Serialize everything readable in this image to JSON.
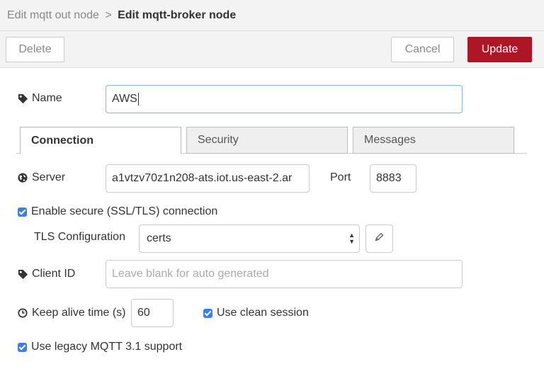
{
  "header": {
    "breadcrumb_prev": "Edit mqtt out node",
    "breadcrumb_sep": ">",
    "title": "Edit mqtt-broker node"
  },
  "toolbar": {
    "delete_label": "Delete",
    "cancel_label": "Cancel",
    "update_label": "Update",
    "update_color": "#ad1625"
  },
  "form": {
    "name_label": "Name",
    "name_value": "AWS",
    "tabs": [
      "Connection",
      "Security",
      "Messages"
    ],
    "active_tab": "Connection",
    "server_label": "Server",
    "server_value": "a1vtzv70z1n208-ats.iot.us-east-2.ar",
    "port_label": "Port",
    "port_value": "8883",
    "tls_checkbox_label": "Enable secure (SSL/TLS) connection",
    "tls_checked": true,
    "tls_config_label": "TLS Configuration",
    "tls_config_value": "certs",
    "client_id_label": "Client ID",
    "client_id_placeholder": "Leave blank for auto generated",
    "keepalive_label": "Keep alive time (s)",
    "keepalive_value": "60",
    "clean_session_label": "Use clean session",
    "clean_session_checked": true,
    "legacy_label": "Use legacy MQTT 3.1 support",
    "legacy_checked": true
  },
  "icons": {
    "name": "tag-icon",
    "server": "globe-icon",
    "client_id": "tag-icon",
    "keepalive": "clock-icon",
    "tls_edit": "pencil-icon"
  }
}
